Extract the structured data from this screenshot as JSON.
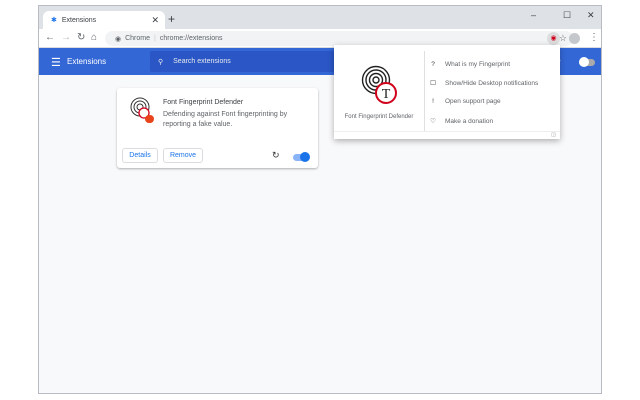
{
  "browser": {
    "tab_title": "Extensions",
    "omnibox_scheme": "Chrome",
    "omnibox_url": "chrome://extensions"
  },
  "header": {
    "title": "Extensions",
    "search_placeholder": "Search extensions",
    "dev_mode_label": "ode",
    "dev_mode_on": false
  },
  "card": {
    "name": "Font Fingerprint Defender",
    "description": "Defending against Font fingerprinting by reporting a fake value.",
    "details_label": "Details",
    "remove_label": "Remove",
    "enabled": true
  },
  "popup": {
    "name": "Font Fingerprint Defender",
    "items": [
      {
        "icon": "question-icon",
        "glyph": "?",
        "label": "What is my Fingerprint"
      },
      {
        "icon": "checkbox-icon",
        "glyph": "☐",
        "label": "Show/Hide Desktop notifications"
      },
      {
        "icon": "exclamation-icon",
        "glyph": "!",
        "label": "Open support page"
      },
      {
        "icon": "heart-icon",
        "glyph": "♡",
        "label": "Make a donation"
      }
    ]
  },
  "colors": {
    "accent": "#3367d6",
    "toggle_on": "#1a73e8",
    "logo_red": "#d0021b"
  }
}
